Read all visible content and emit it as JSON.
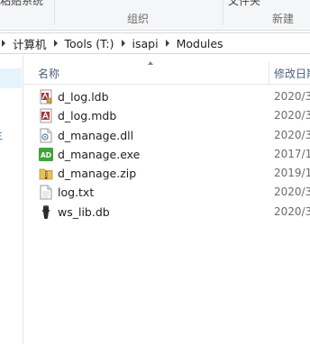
{
  "ribbon": {
    "top_fragment_left": "粘贴系统",
    "top_fragment_right": "文件夹",
    "group_organize": "组织",
    "group_new": "新建"
  },
  "addressbar": {
    "crumbs": [
      "计算机",
      "Tools (T:)",
      "isapi",
      "Modules"
    ]
  },
  "navpane": {
    "edge_mark": "主"
  },
  "filelist": {
    "columns": {
      "name": "名称",
      "date_modified": "修改日期"
    },
    "files": [
      {
        "name": "d_log.ldb",
        "date": "2020/3",
        "icon": "access-lock-file-icon"
      },
      {
        "name": "d_log.mdb",
        "date": "2020/3",
        "icon": "access-database-icon"
      },
      {
        "name": "d_manage.dll",
        "date": "2020/3",
        "icon": "dll-file-icon"
      },
      {
        "name": "d_manage.exe",
        "date": "2017/1",
        "icon": "exe-app-icon"
      },
      {
        "name": "d_manage.zip",
        "date": "2019/1",
        "icon": "zip-archive-icon"
      },
      {
        "name": "log.txt",
        "date": "2020/3",
        "icon": "text-file-icon"
      },
      {
        "name": "ws_lib.db",
        "date": "2020/3",
        "icon": "database-file-icon"
      }
    ]
  },
  "colors": {
    "header_text": "#4c607a",
    "selection": "#e5f3fb",
    "date_text": "#6d6d6d"
  }
}
